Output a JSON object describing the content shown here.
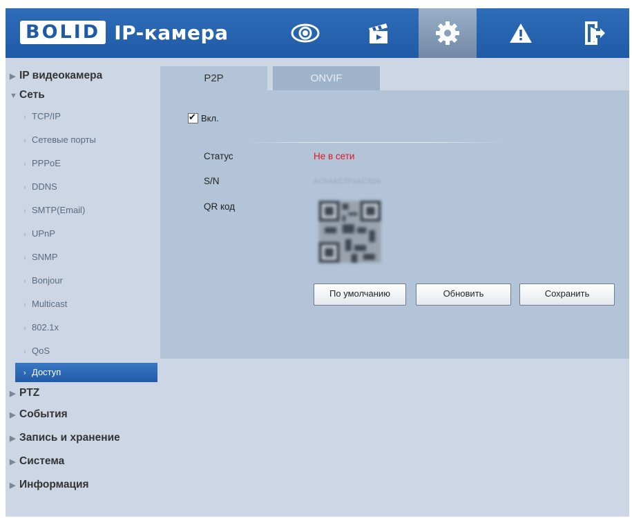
{
  "header": {
    "logo_box": "BOLID",
    "logo_text": "IP-камера",
    "nav": [
      {
        "icon": "eye-icon",
        "name": "live-view"
      },
      {
        "icon": "clapperboard-icon",
        "name": "playback"
      },
      {
        "icon": "gear-icon",
        "name": "settings",
        "active": true
      },
      {
        "icon": "warning-icon",
        "name": "alarm"
      },
      {
        "icon": "exit-icon",
        "name": "logout"
      }
    ],
    "accent_color": "#1f5aa6"
  },
  "sidebar": {
    "top_items": [
      {
        "label": "IP видеокамера",
        "expanded": false
      }
    ],
    "network": {
      "label": "Сеть",
      "expanded": true,
      "children": [
        "TCP/IP",
        "Сетевые порты",
        "PPPoE",
        "DDNS",
        "SMTP(Email)",
        "UPnP",
        "SNMP",
        "Bonjour",
        "Multicast",
        "802.1x",
        "QoS",
        "Доступ"
      ],
      "active_child": "Доступ"
    },
    "bottom_items": [
      {
        "label": "PTZ"
      },
      {
        "label": "События"
      },
      {
        "label": "Запись и хранение"
      },
      {
        "label": "Система"
      },
      {
        "label": "Информация"
      }
    ]
  },
  "tabs": [
    {
      "label": "P2P",
      "active": true
    },
    {
      "label": "ONVIF",
      "active": false
    }
  ],
  "form": {
    "enable_label": "Вкл.",
    "enabled": true,
    "status_label": "Статус",
    "status_value": "Не в сети",
    "status_color": "#e4141c",
    "sn_label": "S/N",
    "sn_value": "AC0AAC2P4AC3D9",
    "qr_label": "QR код",
    "buttons": {
      "default": "По умолчанию",
      "refresh": "Обновить",
      "save": "Сохранить"
    }
  }
}
